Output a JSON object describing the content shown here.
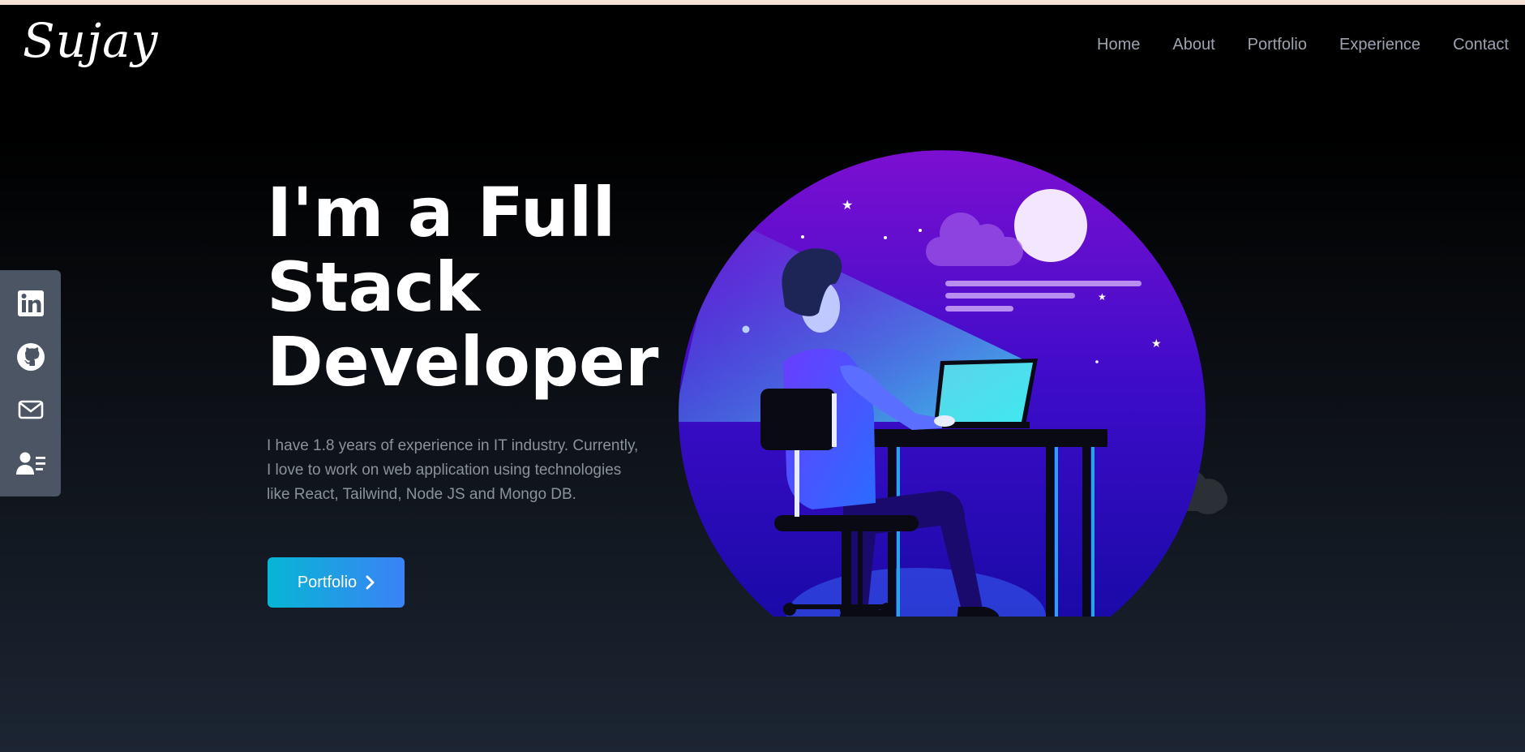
{
  "logo": {
    "text": "Sujay"
  },
  "nav": {
    "items": [
      {
        "label": "Home"
      },
      {
        "label": "About"
      },
      {
        "label": "Portfolio"
      },
      {
        "label": "Experience"
      },
      {
        "label": "Contact"
      }
    ]
  },
  "social": {
    "icons": [
      "linkedin-icon",
      "github-icon",
      "mail-icon",
      "resume-icon"
    ]
  },
  "hero": {
    "title_line1": "I'm a Full",
    "title_line2": "Stack",
    "title_line3": "Developer",
    "description": "I have 1.8 years of experience in IT industry. Currently, I love to work on web application using technologies like React, Tailwind, Node JS and Mongo DB.",
    "cta_label": "Portfolio"
  },
  "colors": {
    "accent_start": "#06b6d4",
    "accent_end": "#3b82f6",
    "social_bar": "#4b5563",
    "illustration_purple": "#7c0fd1",
    "illustration_blue": "#1a0aa8"
  }
}
